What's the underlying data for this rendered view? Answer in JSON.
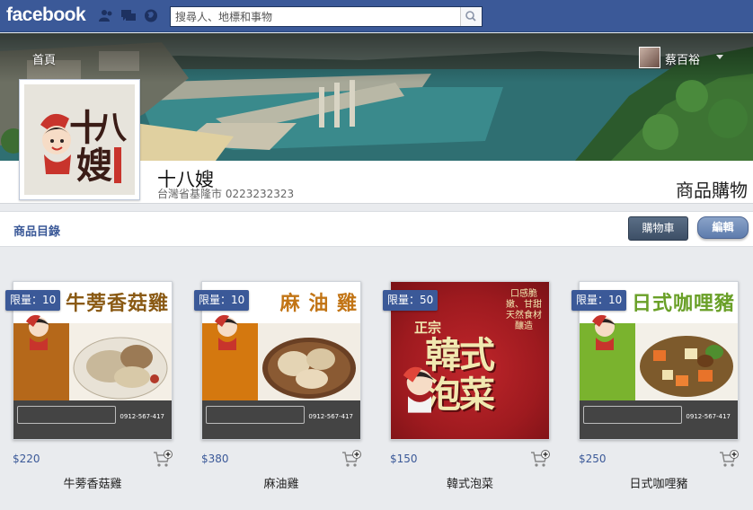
{
  "topbar": {
    "logo": "facebook",
    "search_placeholder": "搜尋人、地標和事物"
  },
  "cover": {
    "nav_home": "首頁",
    "user_name": "蔡百裕"
  },
  "page": {
    "name": "十八嫂",
    "subtitle": "台灣省基隆市 0223232323",
    "tab_title": "商品購物",
    "logo_text": "十八嫂"
  },
  "toolbar": {
    "catalog_label": "商品目錄",
    "cart_label": "購物車",
    "edit_label": "編輯"
  },
  "products": [
    {
      "badge": "限量：10",
      "image_title": "牛蒡香菇雞",
      "price": "$220",
      "name": "牛蒡香菇雞",
      "accent": "#b5681a",
      "phone": "0912-567-417"
    },
    {
      "badge": "限量：10",
      "image_title": "麻 油 雞",
      "price": "$380",
      "name": "麻油雞",
      "accent": "#d4780f",
      "phone": "0912-567-417"
    },
    {
      "badge": "限量：50",
      "image_title": "韓式泡菜",
      "price": "$150",
      "name": "韓式泡菜",
      "accent": "#9e1a1f",
      "side_text": "口感脆嫩、甘甜 天然食材釀造",
      "brand_tag": "正宗"
    },
    {
      "badge": "限量：10",
      "image_title": "日式咖哩豬",
      "price": "$250",
      "name": "日式咖哩豬",
      "accent": "#7ab32e",
      "phone": "0912-567-417"
    }
  ],
  "colors": {
    "fb_blue": "#3b5998",
    "background": "#e9ebee"
  }
}
